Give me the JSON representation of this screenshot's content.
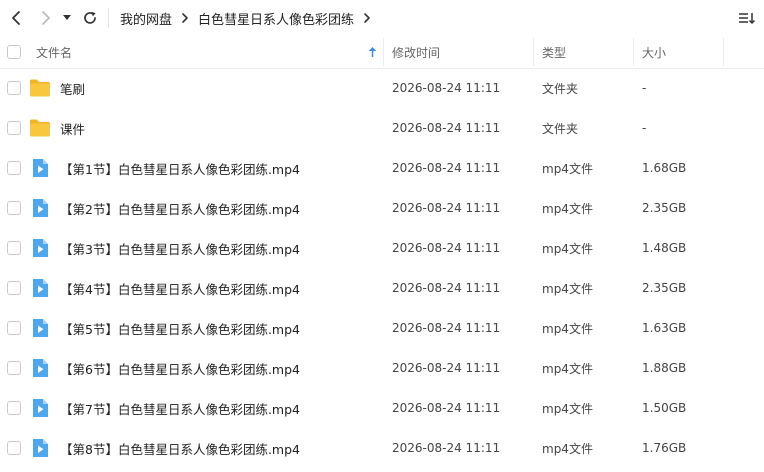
{
  "nav": {
    "back_icon": "chevron-left-icon",
    "forward_icon": "chevron-right-icon",
    "dropdown_icon": "caret-down-icon",
    "refresh_icon": "refresh-icon",
    "sort_icon": "list-sort-icon"
  },
  "breadcrumb": {
    "root": "我的网盘",
    "current": "白色彗星日系人像色彩团练"
  },
  "table": {
    "headers": {
      "name": "文件名",
      "modified": "修改时间",
      "type": "类型",
      "size": "大小"
    },
    "sort_icon": "sort-up-arrow-icon",
    "rows": [
      {
        "icon": "folder-icon",
        "name": "笔刷",
        "modified": "2026-08-24 11:11",
        "type": "文件夹",
        "size": "-"
      },
      {
        "icon": "folder-icon",
        "name": "课件",
        "modified": "2026-08-24 11:11",
        "type": "文件夹",
        "size": "-"
      },
      {
        "icon": "video-file-icon",
        "name": "【第1节】白色彗星日系人像色彩团练.mp4",
        "modified": "2026-08-24 11:11",
        "type": "mp4文件",
        "size": "1.68GB"
      },
      {
        "icon": "video-file-icon",
        "name": "【第2节】白色彗星日系人像色彩团练.mp4",
        "modified": "2026-08-24 11:11",
        "type": "mp4文件",
        "size": "2.35GB"
      },
      {
        "icon": "video-file-icon",
        "name": "【第3节】白色彗星日系人像色彩团练.mp4",
        "modified": "2026-08-24 11:11",
        "type": "mp4文件",
        "size": "1.48GB"
      },
      {
        "icon": "video-file-icon",
        "name": "【第4节】白色彗星日系人像色彩团练.mp4",
        "modified": "2026-08-24 11:11",
        "type": "mp4文件",
        "size": "2.35GB"
      },
      {
        "icon": "video-file-icon",
        "name": "【第5节】白色彗星日系人像色彩团练.mp4",
        "modified": "2026-08-24 11:11",
        "type": "mp4文件",
        "size": "1.63GB"
      },
      {
        "icon": "video-file-icon",
        "name": "【第6节】白色彗星日系人像色彩团练.mp4",
        "modified": "2026-08-24 11:11",
        "type": "mp4文件",
        "size": "1.88GB"
      },
      {
        "icon": "video-file-icon",
        "name": "【第7节】白色彗星日系人像色彩团练.mp4",
        "modified": "2026-08-24 11:11",
        "type": "mp4文件",
        "size": "1.50GB"
      },
      {
        "icon": "video-file-icon",
        "name": "【第8节】白色彗星日系人像色彩团练.mp4",
        "modified": "2026-08-24 11:11",
        "type": "mp4文件",
        "size": "1.76GB"
      }
    ]
  },
  "colors": {
    "folder": "#F9C73D",
    "folder_dark": "#F2B526",
    "video": "#4DA6F0",
    "accent": "#3B8CF0"
  }
}
